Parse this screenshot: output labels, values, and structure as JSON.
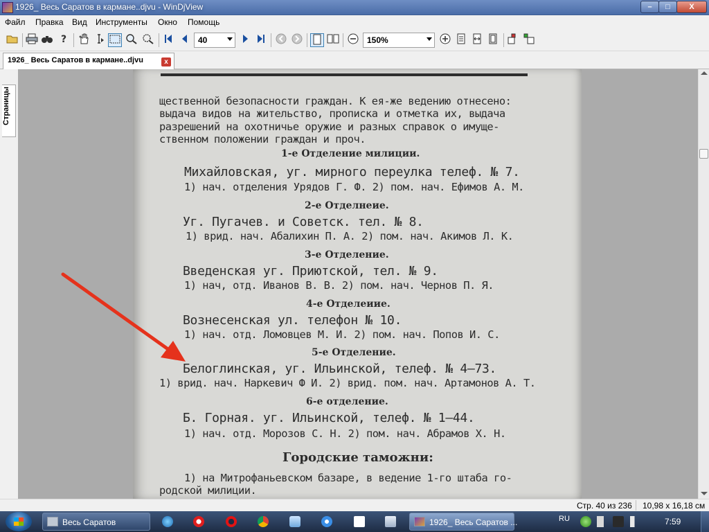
{
  "window": {
    "title": "1926_ Весь Саратов в кармане..djvu - WinDjView",
    "minimize_label": "–",
    "maximize_label": "□",
    "close_label": "X"
  },
  "menu": [
    "Файл",
    "Правка",
    "Вид",
    "Инструменты",
    "Окно",
    "Помощь"
  ],
  "toolbar": {
    "page_number": "40",
    "zoom": "150%"
  },
  "tab": {
    "label": "1926_ Весь Саратов в кармане..djvu",
    "close_label": "x"
  },
  "sidebar": {
    "pages_tab": "Страницы"
  },
  "document": {
    "lines": [
      "щественной безопасности граждан. К ея-же ведению отнесено:",
      "выдача видов на жительство, прописка и отметка их, выдача",
      "разрешений на охотничье оружие и разных справок о имуще-",
      "ственном положении граждан и проч.",
      "1-е Отделение милиции.",
      "Михайловская, уг. мирного переулка телеф. № 7.",
      "1) нач. отделения Урядов Г. Ф. 2) пом. нач. Ефимов А. М.",
      "2-е Отделнеие.",
      "Уг. Пугачев. и Советск. тел. № 8.",
      "1) врид. нач. Абалихин П. А. 2) пом. нач. Акимов Л. К.",
      "3-е Отделение.",
      "Введенская уг. Приютской, тел. № 9.",
      "1) нач, отд. Иванов В. В. 2) пом. нач. Чернов П. Я.",
      "4-е Отделеиие.",
      "Вознесенская ул. телефон № 10.",
      "1) нач. отд. Ломовцев М. И. 2) пом. нач. Попов И. С.",
      "5-е Отделение.",
      "Белоглинская, уг. Ильинской, телеф. № 4—73.",
      "1) врид. нач. Наркевич Ф И. 2) врид. пом. нач. Артамонов А. Т.",
      "6-е отделение.",
      "Б. Горная. уг. Ильинской, телеф. № 1—44.",
      "1) нач. отд. Морозов С. Н. 2) пом. нач. Абрамов Х. Н.",
      "Городские таможни:",
      "1) на Митрофаньевском базаре, в ведение 1-го штаба го-",
      "родской милиции."
    ]
  },
  "status": {
    "page_info": "Стр. 40 из 236",
    "page_size": "10,98 x 16,18 см"
  },
  "taskbar": {
    "task1": "Весь Саратов",
    "task2": "1926_ Весь Саратов ...",
    "lang": "RU",
    "clock": "7:59"
  },
  "colors": {
    "annotation_arrow": "#e5321c",
    "window_frame": "#4a6da8",
    "close_button": "#c14a34"
  }
}
